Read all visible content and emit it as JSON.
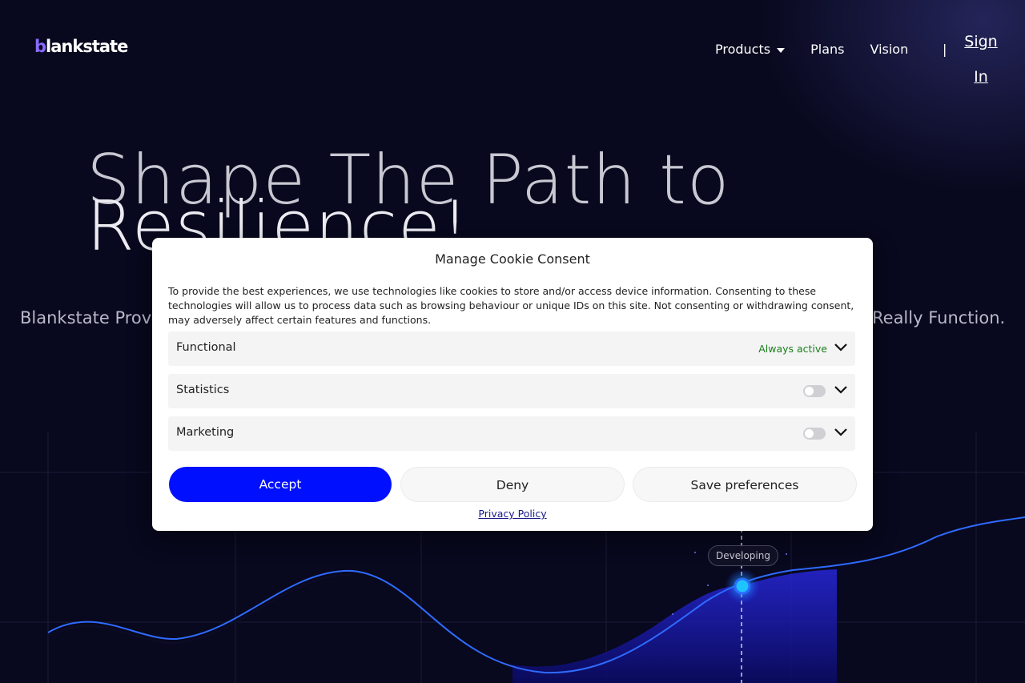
{
  "header": {
    "logo_mark": "b",
    "logo_rest": "lankstate",
    "nav": [
      {
        "label": "Products"
      },
      {
        "label": "Plans"
      },
      {
        "label": "Vision"
      }
    ],
    "separator": "|",
    "signin_label": "Sign In"
  },
  "hero": {
    "title_line1": "Shape The Path to",
    "title_line2": "Resilience!",
    "subtitle_left": "Blankstate Prov",
    "subtitle_right": "Really Function."
  },
  "chart": {
    "badge": "Developing"
  },
  "modal": {
    "title": "Manage Cookie Consent",
    "description": "To provide the best experiences, we use technologies like cookies to store and/or access device information. Consenting to these technologies will allow us to process data such as browsing behaviour or unique IDs on this site. Not consenting or withdrawing consent, may adversely affect certain features and functions.",
    "categories": [
      {
        "label": "Functional",
        "status": "Always active"
      },
      {
        "label": "Statistics"
      },
      {
        "label": "Marketing"
      }
    ],
    "buttons": {
      "accept": "Accept",
      "deny": "Deny",
      "save": "Save preferences"
    },
    "privacy_link": "Privacy Policy"
  },
  "colors": {
    "background": "#08081e",
    "accent": "#0010ff",
    "always_active": "#1a7f1a"
  }
}
